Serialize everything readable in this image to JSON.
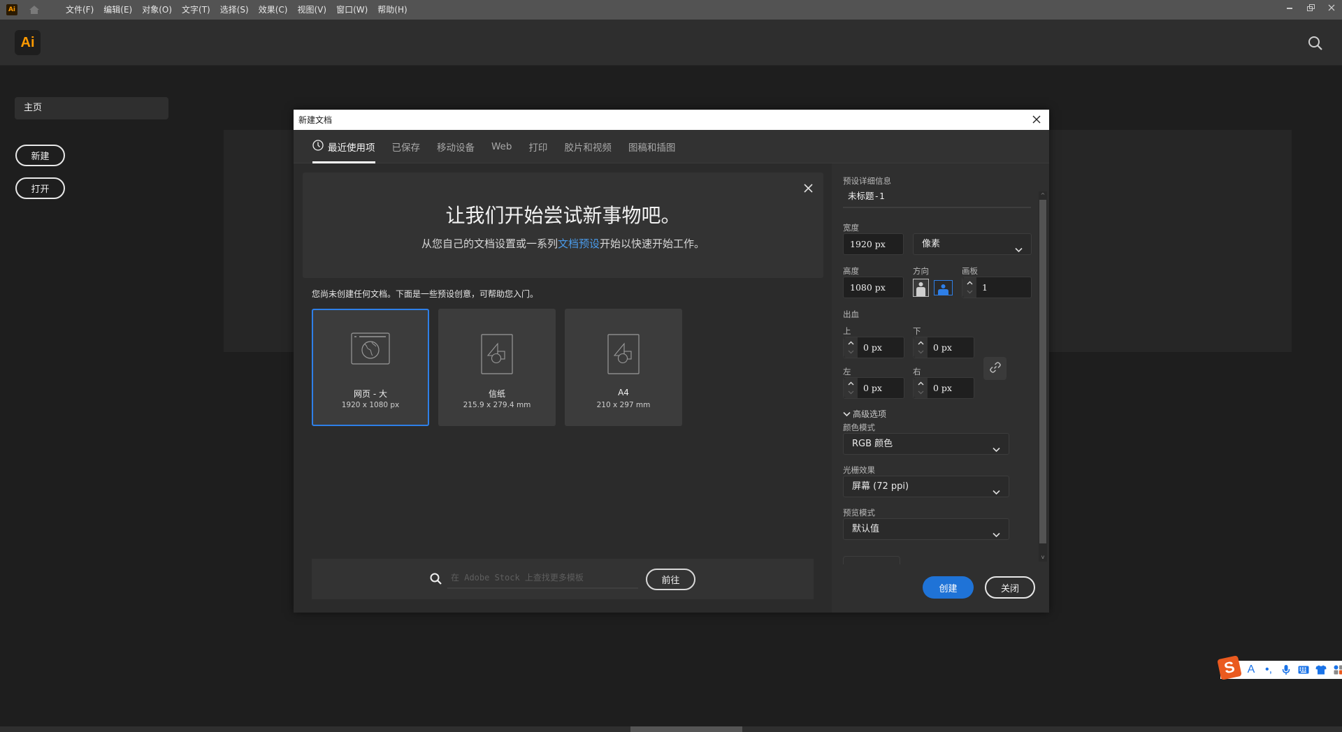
{
  "menubar": {
    "app_badge": "Ai",
    "items": [
      "文件(F)",
      "编辑(E)",
      "对象(O)",
      "文字(T)",
      "选择(S)",
      "效果(C)",
      "视图(V)",
      "窗口(W)",
      "帮助(H)"
    ],
    "window_controls": {
      "minimize": "–",
      "restore": "❐",
      "close": "✕"
    }
  },
  "header": {
    "logo": "Ai"
  },
  "left_nav": {
    "home": "主页",
    "new_button": "新建",
    "open_button": "打开"
  },
  "dialog": {
    "title": "新建文档",
    "tabs": [
      {
        "label": "最近使用项",
        "active": true
      },
      {
        "label": "已保存"
      },
      {
        "label": "移动设备"
      },
      {
        "label": "Web"
      },
      {
        "label": "打印"
      },
      {
        "label": "胶片和视频"
      },
      {
        "label": "图稿和插图"
      }
    ],
    "hero": {
      "title": "让我们开始尝试新事物吧。",
      "subtitle_before": "从您自己的文档设置或一系列",
      "subtitle_link": "文档预设",
      "subtitle_after": "开始以快速开始工作。"
    },
    "empty_note": "您尚未创建任何文档。下面是一些预设创意，可帮助您入门。",
    "presets": [
      {
        "name": "网页 - 大",
        "size": "1920 x 1080 px",
        "icon": "web-globe-icon",
        "selected": true
      },
      {
        "name": "信纸",
        "size": "215.9 x 279.4 mm",
        "icon": "document-shapes-icon"
      },
      {
        "name": "A4",
        "size": "210 x 297 mm",
        "icon": "document-shapes-icon"
      }
    ],
    "stock": {
      "placeholder": "在 Adobe Stock 上查找更多模板",
      "value": "",
      "go_button": "前往"
    },
    "details": {
      "section_label": "预设详细信息",
      "doc_name": "未标题-1",
      "width_label": "宽度",
      "width_value": "1920 px",
      "unit_value": "像素",
      "height_label": "高度",
      "height_value": "1080 px",
      "orientation_label": "方向",
      "orientation_selected": "landscape",
      "artboards_label": "画板",
      "artboards_value": "1",
      "bleed_label": "出血",
      "bleed_top_label": "上",
      "bleed_top": "0 px",
      "bleed_bottom_label": "下",
      "bleed_bottom": "0 px",
      "bleed_left_label": "左",
      "bleed_left": "0 px",
      "bleed_right_label": "右",
      "bleed_right": "0 px",
      "advanced_label": "高级选项",
      "color_mode_label": "颜色模式",
      "color_mode_value": "RGB 颜色",
      "raster_label": "光栅效果",
      "raster_value": "屏幕 (72 ppi)",
      "preview_label": "预览模式",
      "preview_value": "默认值"
    },
    "create_button": "创建",
    "close_button": "关闭"
  },
  "ime": {
    "items": [
      "A",
      "•,",
      "mic",
      "keyboard",
      "shirt",
      "apps"
    ]
  },
  "colors": {
    "accent_blue": "#1f73d7",
    "selected_outline": "#2e7fe8",
    "link_blue": "#4a9bea",
    "ai_orange": "#ff9a00",
    "ime_red": "#ea5a1f"
  }
}
